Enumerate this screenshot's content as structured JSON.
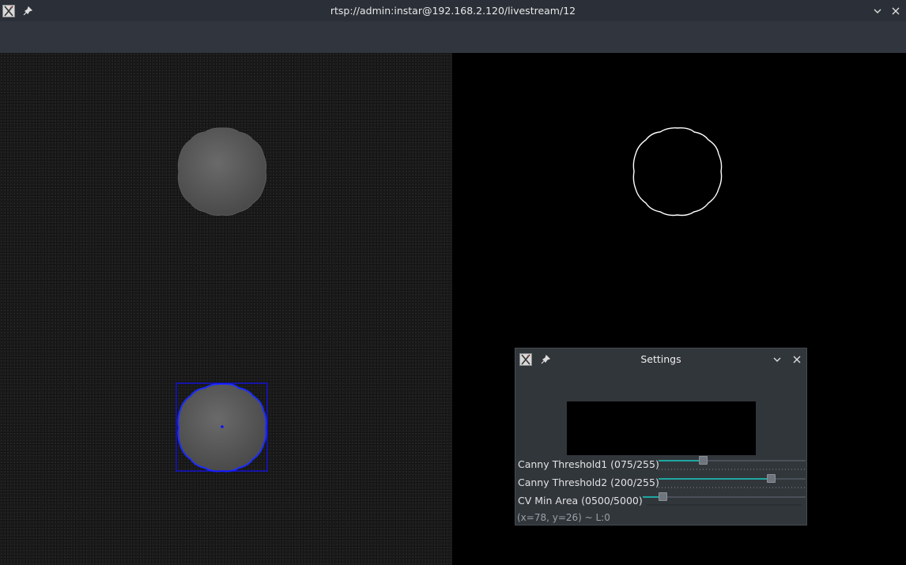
{
  "window": {
    "title": "rtsp://admin:instar@192.168.2.120/livestream/12",
    "app_icon": "x-app-icon",
    "pin_icon": "pin-icon",
    "minimize_icon": "chevron-down-icon",
    "close_icon": "close-icon"
  },
  "settings": {
    "title": "Settings",
    "sliders": [
      {
        "label": "Canny Threshold1 (075/255)",
        "value": 75,
        "max": 255
      },
      {
        "label": "Canny Threshold2 (200/255)",
        "value": 200,
        "max": 255
      },
      {
        "label": "CV Min Area (0500/5000)",
        "value": 500,
        "max": 5000
      }
    ],
    "status": "(x=78, y=26) ~ L:0"
  },
  "colors": {
    "accent": "#1ea7a0",
    "bounding_box": "#0000ff",
    "edge": "#ffffff"
  }
}
